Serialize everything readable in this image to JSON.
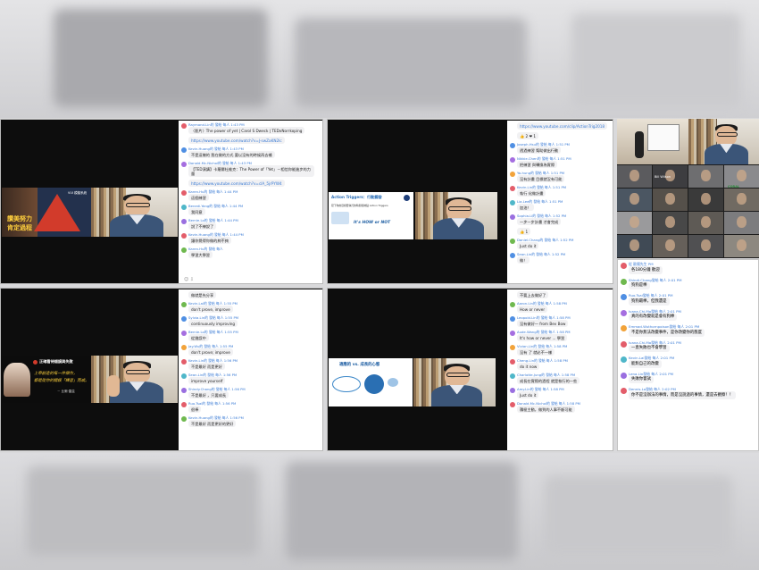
{
  "slides": {
    "p1": {
      "title_lines": [
        "讚美努力",
        "肯定過程"
      ],
      "pyramid_label": "VUI 模擬系統"
    },
    "p2": {
      "title": "Action Triggers：行動觸發",
      "subtitle": "寫下你的目標要執行的時間和地點 Action Triggers",
      "tagline": "It's HOW or NOT"
    },
    "p3": {
      "title": "正確看待錯誤與失敗",
      "quote_lines": [
        "上帝創造的每一件傑作，",
        "都是從你的錯誤「練習」而成。"
      ],
      "quote_author": "－ 比爾‧蓋茲"
    },
    "p4": {
      "title": "適應的 vs. 成長的心態"
    }
  },
  "chat_p1": [
    {
      "name": "Raymond.Lin的 發給 每人 1:43 PM",
      "text": "〈影片〉The power of yet | Carol S Dweck | TEDxNorrkoping"
    },
    {
      "name": "",
      "text": "https://www.youtube.com/watch?v=J-swZaKN2Ic",
      "link": true
    },
    {
      "name": "Kevin.Huang的 發給 每人 1:43 PM",
      "text": "不是這樣的 我在做的方式 要以沒有的時候再去補"
    },
    {
      "name": "Donald.Mc.Nichol的 發給 每人 1:43 PM",
      "text": "【TED演講】卡羅爾杜維克：The Power of「Yet」－相信你能進步的力量"
    },
    {
      "name": "",
      "text": "https://www.youtube.com/watch?v=clA_5jrPYW4",
      "link": true
    },
    {
      "name": "Karen.Hu的 發給 每人 1:44 PM",
      "text": "這個練習"
    },
    {
      "name": "Benedi.Yang的 發給 每人 1:44 PM",
      "text": "我同意"
    },
    {
      "name": "Bernie.Lo的 發給 每人 1:44 PM",
      "text": "說了不練說了"
    },
    {
      "name": "Kevin.Huang的 發給 每人 1:44 PM",
      "text": "讓你覺得你做的夠不夠"
    },
    {
      "name": "Karen.Hu的 發給 每人",
      "text": "學習大學習"
    }
  ],
  "chat_p2": [
    {
      "name": "",
      "text": "https://www.youtube.com/clip/ActionTrig2018",
      "link": true
    },
    {
      "name": "",
      "text": "👍 2  ❤ 1"
    },
    {
      "name": "Joseph.Hsu的 發給 每人 1:51 PM",
      "text": "透過練習 幫助做出行動"
    },
    {
      "name": "Nikkie.Chen的 發給 每人 1:51 PM",
      "text": "把練習 與轉換為實際"
    },
    {
      "name": "Ya-hung的 發給 每人 1:51 PM",
      "text": "沒有計畫 目標就沒有可能"
    },
    {
      "name": "Kevin.Lin的 發給 每人 1:51 PM",
      "text": "執行 化做計畫"
    },
    {
      "name": "Lia.Lee的 發給 每人 1:51 PM",
      "text": "加油！"
    },
    {
      "name": "Sophia.Li的 發給 每人 1:52 PM",
      "text": "一步一步計畫 才會完成"
    },
    {
      "name": "",
      "text": "👍 1"
    },
    {
      "name": "Daniel.Chang的 發給 每人 1:52 PM",
      "text": "Just do it"
    },
    {
      "name": "Sean.Lin的 發給 每人 1:52 PM",
      "text": "做！"
    }
  ],
  "chat_p3": [
    {
      "name": "",
      "text": "做就是先分享"
    },
    {
      "name": "Kevin.Lai的 發給 每人 1:55 PM",
      "text": "don't prove, improve"
    },
    {
      "name": "Sylvia.Lin的 發給 每人 1:55 PM",
      "text": "continuously improving"
    },
    {
      "name": "Bernie.Lo的 發給 每人 1:55 PM",
      "text": "從錯誤中"
    },
    {
      "name": "Jay.Wu的 發給 每人 1:55 PM",
      "text": "don't prove; improve"
    },
    {
      "name": "Kevin.Lin的 發給 每人 1:56 PM",
      "text": "不是最好 而是更好"
    },
    {
      "name": "Sean.Lin的 發給 每人 1:56 PM",
      "text": "improve yourself"
    },
    {
      "name": "Shindy.Chang的 發給 每人 1:56 PM",
      "text": "不是最好 ，只要成長"
    },
    {
      "name": "Ruo.Tsai的 發給 每人 1:56 PM",
      "text": "很棒"
    },
    {
      "name": "Kevin.Huang的 發給 每人 1:56 PM",
      "text": "不是最好 而是更好的更好"
    }
  ],
  "chat_p4": [
    {
      "name": "",
      "text": "不要上去做好了"
    },
    {
      "name": "Aaron.Lin的 發給 每人 1:58 PM",
      "text": "How or never"
    },
    {
      "name": "Leopold.Lin的 發給 每人 1:58 PM",
      "text": "沒有做好一 from Bev Bow"
    },
    {
      "name": "Aude.Wang的 發給 每人 1:58 PM",
      "text": "It's how or never  ... 學習"
    },
    {
      "name": "Vivian.Lin的 發給 每人 1:58 PM",
      "text": "沒有 了 就必不一樣"
    },
    {
      "name": "Cheng.Lin的 發給 每人 1:58 PM",
      "text": "do it now"
    },
    {
      "name": "Charlotte.Jung的 發給 每人 1:58 PM",
      "text": "成長在實際的過程 就是執行的一些"
    },
    {
      "name": "Amy.Lin的 發給 每人 1:58 PM",
      "text": "Just do it"
    },
    {
      "name": "Donald.Mc.Nichol的 發給 每人 1:58 PM",
      "text": "積極主動，做到的人事不斷可能"
    }
  ],
  "chat_right": [
    {
      "name": "從 歐陽先生 PM",
      "text": "各180分鐘 歡迎"
    },
    {
      "name": "Shindi.Chang發給 每人 2:01 PM",
      "text": "狗狗是棒"
    },
    {
      "name": "Ruo.Tsai發給 每人 2:01 PM",
      "text": "狗狗最棒，但我還是"
    },
    {
      "name": "Ivana.Chi.Ma發給 每人 2:01 PM",
      "text": "真的有改變就是會有狗棒"
    },
    {
      "name": "Emmad.Wuthornpoison發給 每人 2:01 PM",
      "text": "不是你無法改變事件，是你改變你的態度"
    },
    {
      "name": "Ivana.Chi.Ma發給 每人 2:01 PM",
      "text": "一直失敗也不會學習"
    },
    {
      "name": "Kevin.Lai發給 每人 2:01 PM",
      "text": "能對自己的改變"
    },
    {
      "name": "Lena.Lin發給 每人 2:01 PM",
      "text": "失敗你嘗試"
    },
    {
      "name": "Dennis.Lo發給 每人 2:02 PM",
      "text": "你不是沒辦法的事情，而是沒說過的事情，還是去觀察！！"
    }
  ],
  "zoom": {
    "presenter_label": "Bill Wilson",
    "logo_label": "CORAL"
  },
  "colors": {
    "avatars": [
      "#e35d6a",
      "#6fb94f",
      "#4f8fe3",
      "#a56ee0",
      "#f2a33a",
      "#e35d6a",
      "#4fb7c9",
      "#9a6fe0"
    ]
  }
}
